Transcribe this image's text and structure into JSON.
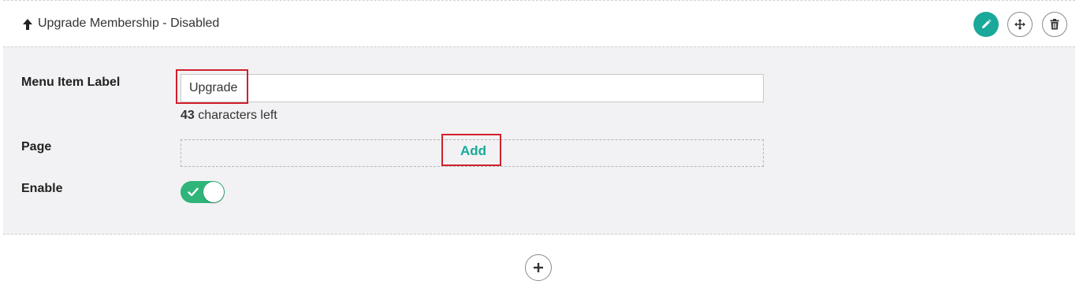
{
  "header": {
    "title": "Upgrade Membership - Disabled",
    "icons": {
      "direction": "arrow-up-icon",
      "edit": "pencil-icon",
      "move": "move-icon",
      "delete": "trash-icon"
    }
  },
  "form": {
    "menu_item_label": {
      "label": "Menu Item Label",
      "value": "Upgrade",
      "chars_left_count": "43",
      "chars_left_text": "characters left"
    },
    "page": {
      "label": "Page",
      "add_label": "Add"
    },
    "enable": {
      "label": "Enable",
      "checked": true
    }
  },
  "footer": {
    "add_icon": "plus-icon"
  },
  "colors": {
    "accent": "#1aa89a",
    "toggle_on": "#2fb57a",
    "highlight": "#d0202c",
    "panel_bg": "#f2f2f4"
  }
}
